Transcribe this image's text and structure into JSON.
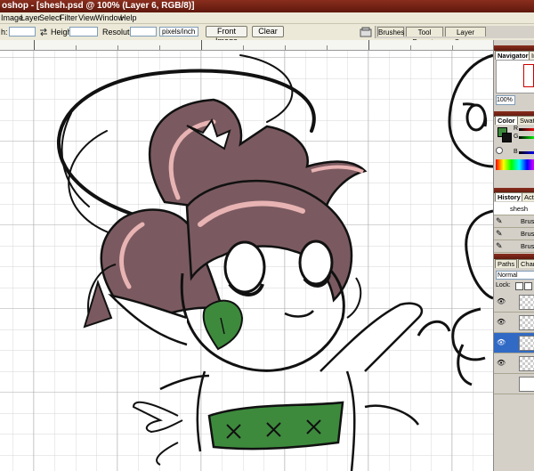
{
  "window": {
    "title": "oshop - [shesh.psd @ 100% (Layer 6, RGB/8)]"
  },
  "menu": [
    "Image",
    "Layer",
    "Select",
    "Filter",
    "View",
    "Window",
    "Help"
  ],
  "options": {
    "width_label": "h:",
    "height_label": "Height:",
    "resolution_label": "Resolution:",
    "unit_value": "pixels/inch",
    "front_image_label": "Front Image",
    "clear_label": "Clear"
  },
  "well_tabs": [
    "Brushes",
    "Tool Presets",
    "Layer Comps"
  ],
  "panels": {
    "navigator": {
      "tabs": [
        "Navigator",
        "In"
      ],
      "zoom": "100%"
    },
    "color": {
      "tabs": [
        "Color",
        "Swatc"
      ],
      "channels": [
        "R",
        "G",
        "B"
      ]
    },
    "history": {
      "tabs": [
        "History",
        "Acti"
      ],
      "items": [
        "shesh",
        "Brush",
        "Brush",
        "Brush"
      ]
    },
    "layers": {
      "tabs": [
        "Paths",
        "Chann"
      ],
      "blend_mode": "Normal",
      "lock_label": "Lock:"
    }
  },
  "colors": {
    "title_bar": "#6e2114",
    "hair_shade": "#7a5a60",
    "hair_highlight": "#e8b3b3",
    "leaf_green": "#3d8a3d"
  }
}
